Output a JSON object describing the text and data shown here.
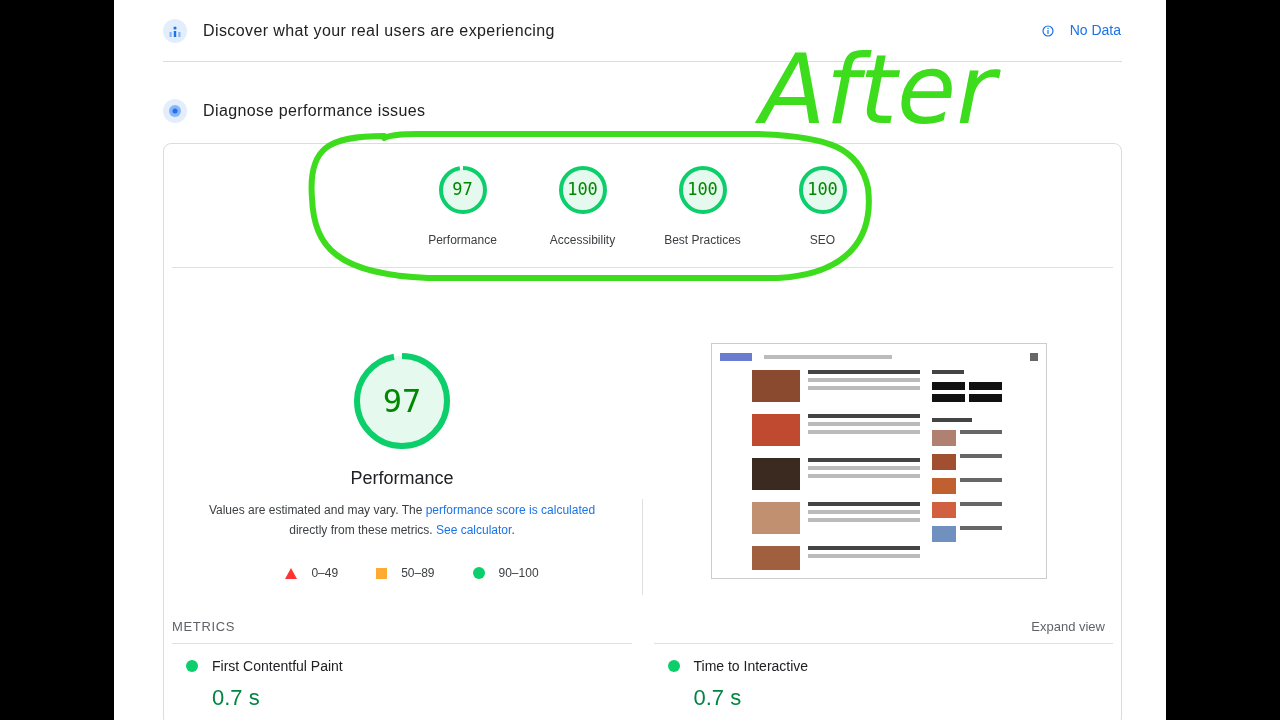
{
  "sections": [
    {
      "kind": "field",
      "title": "Discover what your real users are experiencing",
      "status": "No Data"
    },
    {
      "kind": "lab",
      "title": "Diagnose performance issues"
    }
  ],
  "categories": [
    {
      "score": "97",
      "label": "Performance",
      "level": 0.97
    },
    {
      "score": "100",
      "label": "Accessibility",
      "level": 1
    },
    {
      "score": "100",
      "label": "Best Practices",
      "level": 1
    },
    {
      "score": "100",
      "label": "SEO",
      "level": 1
    }
  ],
  "main_gauge": {
    "score": "97",
    "level": 0.97,
    "label": "Performance"
  },
  "description": {
    "text": "Values are estimated and may vary. The ",
    "link1": "performance score is calculated",
    "middle": " directly from these metrics. ",
    "link2": "See calculator",
    "end": "."
  },
  "legend": [
    {
      "kind": "triangle",
      "range": "0–49",
      "color": "#ff3333"
    },
    {
      "kind": "square",
      "range": "50–89",
      "color": "#ffaa33"
    },
    {
      "kind": "circle",
      "range": "90–100",
      "color": "#0cce6b"
    }
  ],
  "metrics_header": {
    "title": "METRICS",
    "action": "Expand view"
  },
  "metrics": [
    {
      "name": "First Contentful Paint",
      "value": "0.7 s",
      "color": "#0cce6b"
    },
    {
      "name": "Time to Interactive",
      "value": "0.7 s",
      "color": "#0cce6b"
    }
  ],
  "annotation": {
    "text": "After"
  }
}
